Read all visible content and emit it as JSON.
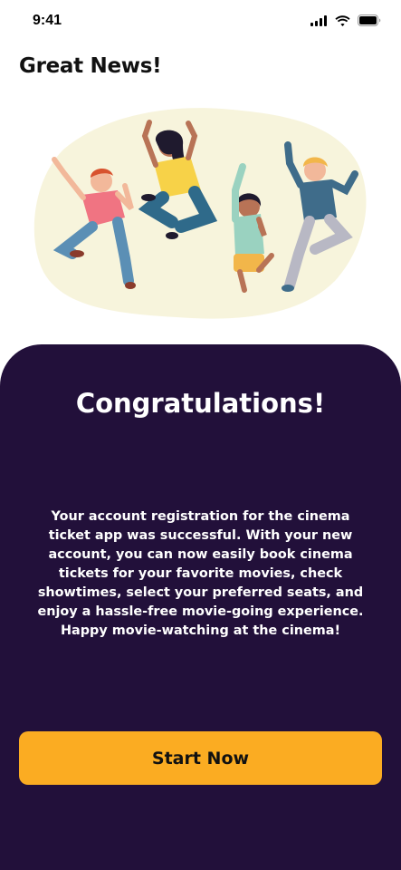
{
  "status_bar": {
    "time": "9:41",
    "icons": [
      "cellular-signal-icon",
      "wifi-icon",
      "battery-icon"
    ]
  },
  "page": {
    "title": "Great News!"
  },
  "illustration": {
    "name": "people-jumping-celebration-illustration",
    "blob_color": "#f7f4dc"
  },
  "card": {
    "background": "#22103a",
    "title": "Congratulations!",
    "message": "Your account registration for the cinema ticket app was successful. With your new account, you can now easily book cinema tickets for your favorite movies, check showtimes, select your preferred seats, and enjoy a hassle-free movie-going experience. Happy movie-watching at the cinema!"
  },
  "button": {
    "label": "Start Now",
    "color": "#fbac22"
  }
}
